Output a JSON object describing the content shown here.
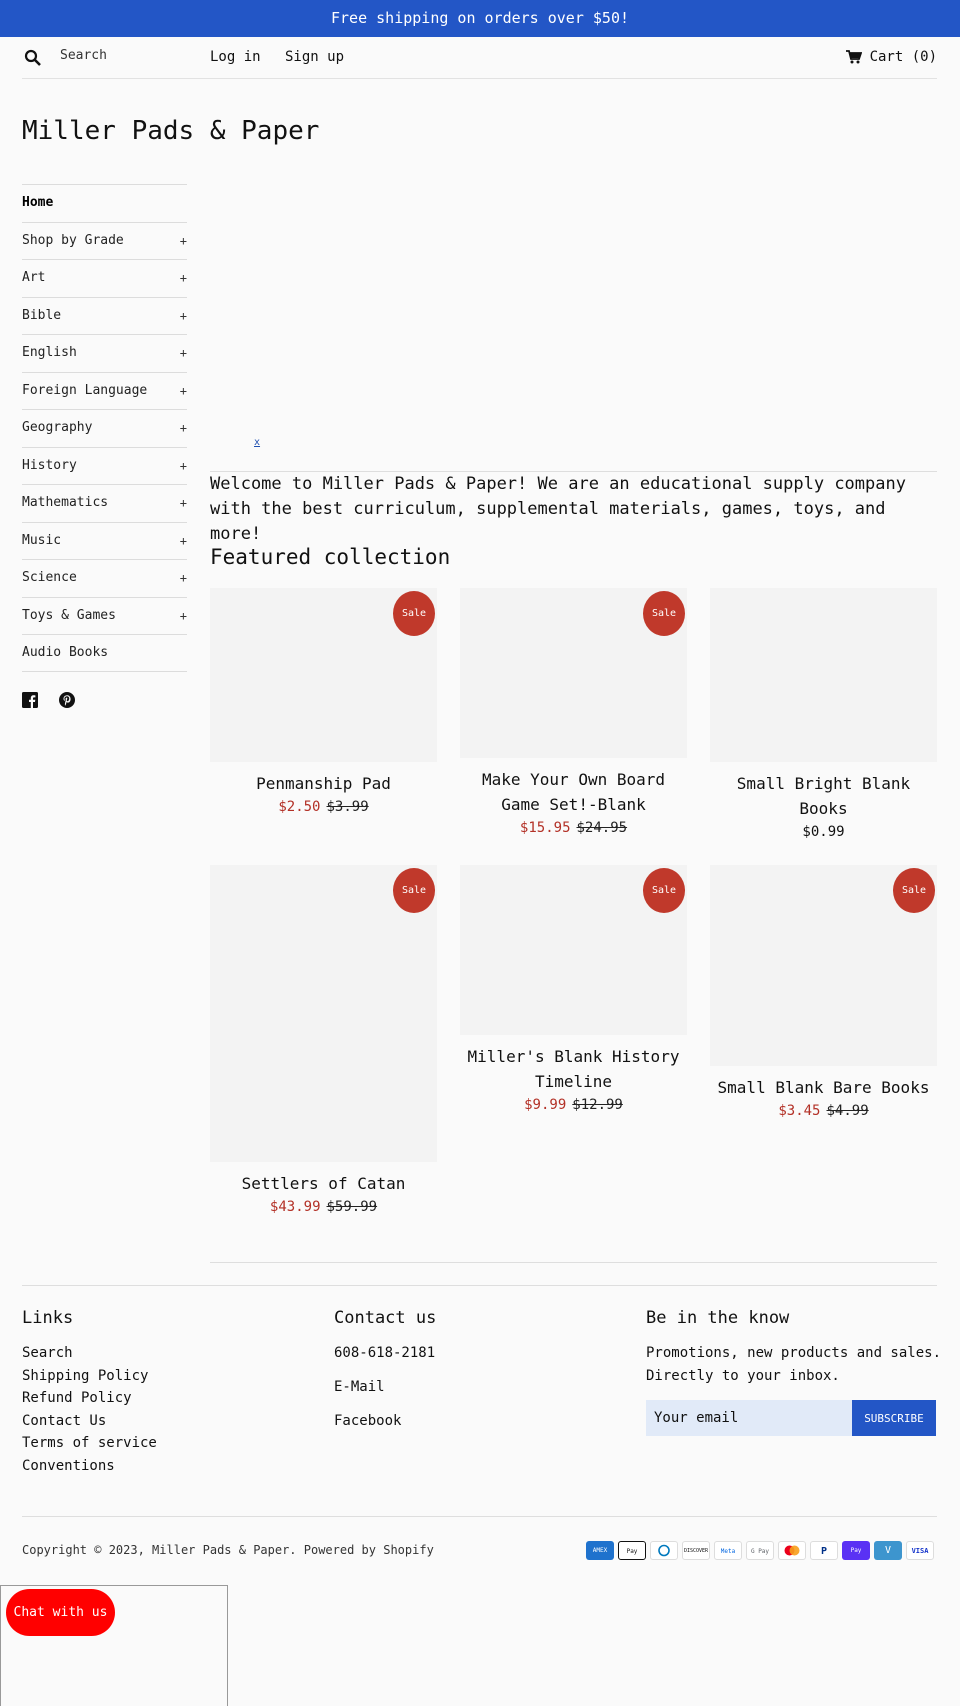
{
  "announcement": "Free shipping on orders over $50!",
  "header": {
    "search_placeholder": "Search",
    "login": "Log in",
    "signup": "Sign up",
    "cart": "Cart (0)"
  },
  "site_title": "Miller Pads & Paper",
  "sidebar": {
    "items": [
      {
        "label": "Home",
        "plus": ""
      },
      {
        "label": "Shop by Grade",
        "plus": "+"
      },
      {
        "label": "Art",
        "plus": "+"
      },
      {
        "label": "Bible",
        "plus": "+"
      },
      {
        "label": "English",
        "plus": "+"
      },
      {
        "label": "Foreign Language",
        "plus": "+"
      },
      {
        "label": "Geography",
        "plus": "+"
      },
      {
        "label": "History",
        "plus": "+"
      },
      {
        "label": "Mathematics",
        "plus": "+"
      },
      {
        "label": "Music",
        "plus": "+"
      },
      {
        "label": "Science",
        "plus": "+"
      },
      {
        "label": "Toys & Games",
        "plus": "+"
      },
      {
        "label": "Audio Books",
        "plus": ""
      }
    ],
    "social": [
      "facebook-icon",
      "pinterest-icon"
    ]
  },
  "hero_mark": "x",
  "welcome": "Welcome to Miller Pads & Paper! We are an educational supply company with the best curriculum, supplemental materials, games, toys, and more!",
  "featured_title": "Featured collection",
  "sale_label": "Sale",
  "products": [
    {
      "name": "Penmanship Pad",
      "sale_price": "$2.50",
      "orig_price": "$3.99"
    },
    {
      "name": "Make Your Own Board Game Set!-Blank",
      "sale_price": "$15.95",
      "orig_price": "$24.95"
    },
    {
      "name": "Small Bright Blank Books",
      "price": "$0.99"
    },
    {
      "name": "Settlers of Catan",
      "sale_price": "$43.99",
      "orig_price": "$59.99"
    },
    {
      "name": "Miller's Blank History Timeline",
      "sale_price": "$9.99",
      "orig_price": "$12.99"
    },
    {
      "name": "Small Blank Bare Books",
      "sale_price": "$3.45",
      "orig_price": "$4.99"
    }
  ],
  "footer": {
    "links_title": "Links",
    "links": [
      "Search",
      "Shipping Policy",
      "Refund Policy",
      "Contact Us",
      "Terms of service",
      "Conventions"
    ],
    "contact_title": "Contact us",
    "contact": [
      "608-618-2181",
      "E-Mail",
      "Facebook"
    ],
    "know_title": "Be in the know",
    "know_text": "Promotions, new products and sales. Directly to your inbox.",
    "email_placeholder": "Your email",
    "subscribe": "SUBSCRIBE",
    "copyright": "Copyright © 2023, Miller Pads & Paper. Powered by Shopify",
    "payments": [
      {
        "icon": "amex-icon",
        "label": "AMEX",
        "color": "#1f72cd"
      },
      {
        "icon": "apple-pay-icon",
        "label": "Pay",
        "color": "#ffffff"
      },
      {
        "icon": "diners-club-icon",
        "label": "",
        "color": "#ffffff"
      },
      {
        "icon": "discover-icon",
        "label": "DISCOVER",
        "color": "#ffffff"
      },
      {
        "icon": "meta-pay-icon",
        "label": "Meta",
        "color": "#ffffff"
      },
      {
        "icon": "google-pay-icon",
        "label": "G Pay",
        "color": "#ffffff"
      },
      {
        "icon": "mastercard-icon",
        "label": "",
        "color": "#ffffff"
      },
      {
        "icon": "paypal-icon",
        "label": "P",
        "color": "#ffffff"
      },
      {
        "icon": "shop-pay-icon",
        "label": "Pay",
        "color": "#5a31f4"
      },
      {
        "icon": "venmo-icon",
        "label": "V",
        "color": "#3d95ce"
      },
      {
        "icon": "visa-icon",
        "label": "VISA",
        "color": "#ffffff"
      }
    ]
  },
  "chat": "Chat with us",
  "colors": {
    "brand_blue": "#2356c6",
    "sale_red": "#c0392b",
    "chat_red": "#ff0000"
  }
}
